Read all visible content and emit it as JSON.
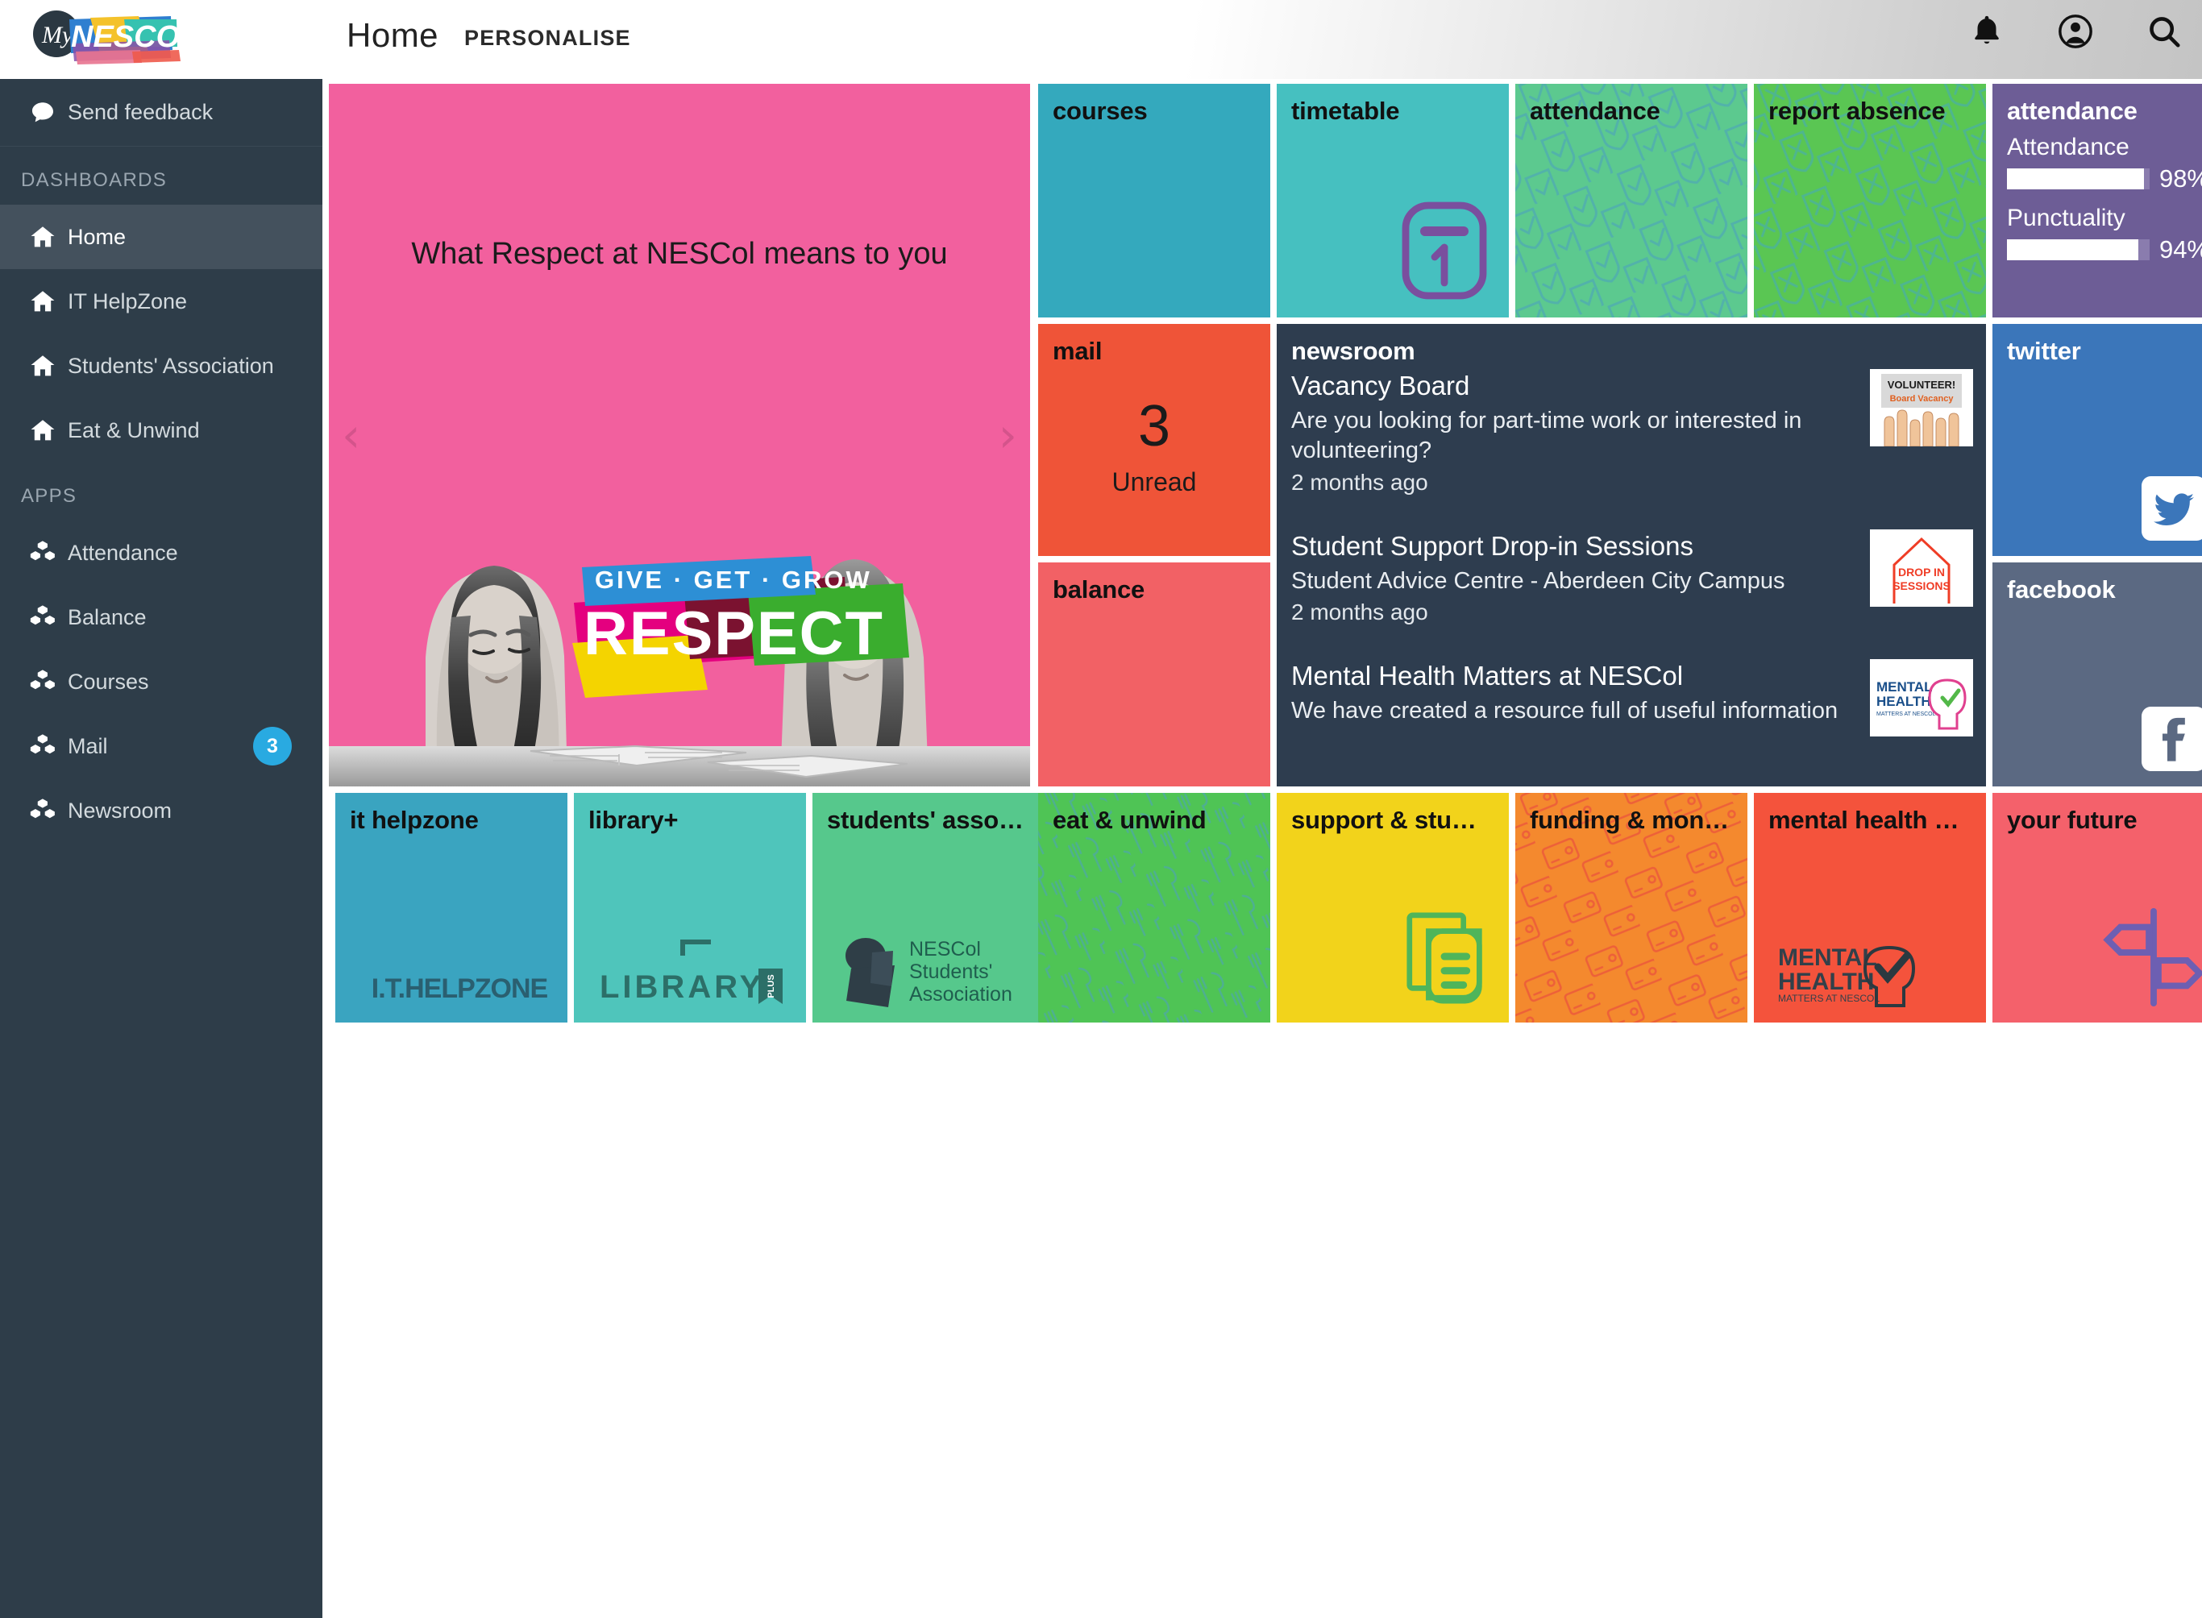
{
  "header": {
    "logo_my": "My",
    "logo_nescol": "NESCOL",
    "nav_home": "Home",
    "nav_personalise": "PERSONALISE",
    "icons": [
      "bell-icon",
      "account-icon",
      "search-icon"
    ]
  },
  "sidebar": {
    "feedback": {
      "label": "Send feedback",
      "icon": "comment-icon"
    },
    "dashboards_heading": "DASHBOARDS",
    "dashboards": [
      {
        "label": "Home",
        "icon": "home-icon",
        "active": true
      },
      {
        "label": "IT HelpZone",
        "icon": "home-icon",
        "active": false
      },
      {
        "label": "Students' Association",
        "icon": "home-icon",
        "active": false
      },
      {
        "label": "Eat & Unwind",
        "icon": "home-icon",
        "active": false
      }
    ],
    "apps_heading": "APPS",
    "apps": [
      {
        "label": "Attendance",
        "icon": "cubes-icon",
        "badge": ""
      },
      {
        "label": "Balance",
        "icon": "cubes-icon",
        "badge": ""
      },
      {
        "label": "Courses",
        "icon": "cubes-icon",
        "badge": ""
      },
      {
        "label": "Mail",
        "icon": "cubes-icon",
        "badge": "3"
      },
      {
        "label": "Newsroom",
        "icon": "cubes-icon",
        "badge": ""
      }
    ]
  },
  "hero": {
    "caption": "What Respect at NESCol means to you",
    "badge_top": "GIVE · GET · GROW",
    "badge_main": "RESPECT",
    "prev": "‹",
    "next": "›"
  },
  "tiles": {
    "courses": {
      "title": "courses",
      "color": "#34a9bd"
    },
    "timetable": {
      "title": "timetable",
      "color": "#46c0c0",
      "icon": "calendar-icon"
    },
    "attendance_green": {
      "title": "attendance",
      "color": "#5cc98f",
      "icon": "check-shield-pattern"
    },
    "report_absence": {
      "title": "report absence",
      "color": "#5ac653",
      "icon": "x-shield-pattern"
    },
    "attendance_stats": {
      "title": "attendance",
      "color": "#6d5d96",
      "stats": [
        {
          "label": "Attendance",
          "value": 98,
          "display": "98%"
        },
        {
          "label": "Punctuality",
          "value": 94,
          "display": "94%"
        }
      ]
    },
    "mail": {
      "title": "mail",
      "color": "#ef5438",
      "count": "3",
      "count_label": "Unread"
    },
    "balance": {
      "title": "balance",
      "color": "#f26165"
    },
    "twitter": {
      "title": "twitter",
      "color": "#3b76ba",
      "icon": "twitter-icon"
    },
    "facebook": {
      "title": "facebook",
      "color": "#5b6982",
      "icon": "facebook-icon"
    },
    "it_helpzone": {
      "title": "it helpzone",
      "color": "#3aa4c0",
      "logo": "I.T.HELPZONE"
    },
    "library": {
      "title": "library+",
      "color": "#4fc5bb",
      "logo": "LIBRARY",
      "logo_sub": "PLUS"
    },
    "students_assoc": {
      "title": "students' asso…",
      "color": "#56c88c",
      "logo_l1": "NESCol",
      "logo_l2": "Students'",
      "logo_l3": "Association"
    },
    "eat_unwind": {
      "title": "eat & unwind",
      "color": "#4fc455",
      "icon": "cutlery-pattern"
    },
    "support_study": {
      "title": "support & stu…",
      "color": "#f2d31b",
      "icon": "documents-icon"
    },
    "funding_money": {
      "title": "funding & mon…",
      "color": "#f4892e",
      "icon": "wallet-pattern"
    },
    "mental_health": {
      "title": "mental health …",
      "color": "#f4533c",
      "logo_l1": "MENTAL",
      "logo_l2": "HEALTH",
      "logo_l3": "MATTERS AT NESCOL"
    },
    "your_future": {
      "title": "your future",
      "color": "#f4616b",
      "icon": "signpost-icon"
    }
  },
  "newsroom": {
    "title": "newsroom",
    "items": [
      {
        "headline": "Vacancy Board",
        "description": "Are you looking for part-time work or interested in volunteering?",
        "time": "2 months ago",
        "thumb": "volunteer-board-vacancy",
        "thumb_l1": "VOLUNTEER!",
        "thumb_l2": "Board Vacancy"
      },
      {
        "headline": "Student Support Drop-in Sessions",
        "description": "Student Advice Centre - Aberdeen City Campus",
        "time": "2 months ago",
        "thumb": "drop-in-sessions",
        "thumb_l1": "DROP IN",
        "thumb_l2": "SESSIONS"
      },
      {
        "headline": "Mental Health Matters at NESCol",
        "description": "We have created a resource full of useful information",
        "time": "",
        "thumb": "mental-health",
        "thumb_l1": "MENTAL",
        "thumb_l2": "HEALTH"
      }
    ]
  }
}
